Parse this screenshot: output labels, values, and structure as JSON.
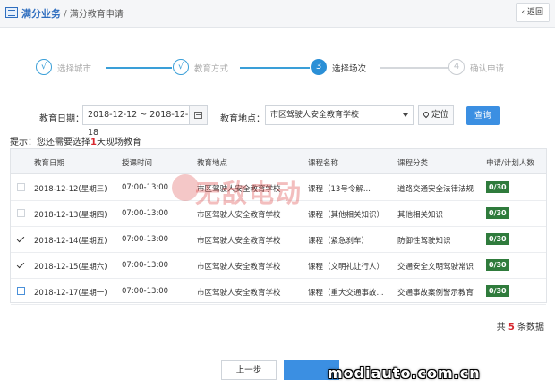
{
  "header": {
    "section": "满分业务",
    "separator": "/",
    "current": "满分教育申请",
    "back_label": "返回"
  },
  "steps": [
    {
      "index": "√",
      "label": "选择城市",
      "state": "done"
    },
    {
      "index": "√",
      "label": "教育方式",
      "state": "done"
    },
    {
      "index": "3",
      "label": "选择场次",
      "state": "active"
    },
    {
      "index": "4",
      "label": "确认申请",
      "state": "pending"
    }
  ],
  "filter": {
    "date_label": "教育日期：",
    "date_value": "2018-12-12 ~ 2018-12-18",
    "place_label": "教育地点：",
    "place_value": "市区驾驶人安全教育学校",
    "locate_label": "定位",
    "query_label": "查询"
  },
  "hint": {
    "prefix": "提示：您还需要选择",
    "count": "1",
    "suffix": "天现场教育"
  },
  "table": {
    "columns": [
      "教育日期",
      "授课时间",
      "教育地点",
      "课程名称",
      "课程分类",
      "申请/计划人数"
    ],
    "rows": [
      {
        "checked": false,
        "date": "2018-12-12(星期三)",
        "time": "07:00-13:00",
        "place": "市区驾驶人安全教育学校",
        "course": "课程（13号令解...",
        "category": "道路交通安全法律法规",
        "count": "0/30"
      },
      {
        "checked": false,
        "date": "2018-12-13(星期四)",
        "time": "07:00-13:00",
        "place": "市区驾驶人安全教育学校",
        "course": "课程（其他相关知识）",
        "category": "其他相关知识",
        "count": "0/30"
      },
      {
        "checked": true,
        "date": "2018-12-14(星期五)",
        "time": "07:00-13:00",
        "place": "市区驾驶人安全教育学校",
        "course": "课程（紧急刹车）",
        "category": "防御性驾驶知识",
        "count": "0/30"
      },
      {
        "checked": true,
        "date": "2018-12-15(星期六)",
        "time": "07:00-13:00",
        "place": "市区驾驶人安全教育学校",
        "course": "课程（文明礼让行人）",
        "category": "交通安全文明驾驶常识",
        "count": "0/30"
      },
      {
        "checked": false,
        "date": "2018-12-17(星期一)",
        "time": "07:00-13:00",
        "place": "市区驾驶人安全教育学校",
        "course": "课程（重大交通事故...",
        "category": "交通事故案例警示教育",
        "count": "0/30"
      }
    ]
  },
  "total": {
    "prefix": "共",
    "count": "5",
    "suffix": "条数据"
  },
  "buttons": {
    "prev_label": "上一步"
  },
  "watermarks": {
    "center": "无敌电动",
    "site": "modiauto.com.cn"
  },
  "colors": {
    "accent": "#3b8fe2",
    "badge": "#2f7b3c",
    "hint_red": "#d7282f"
  }
}
